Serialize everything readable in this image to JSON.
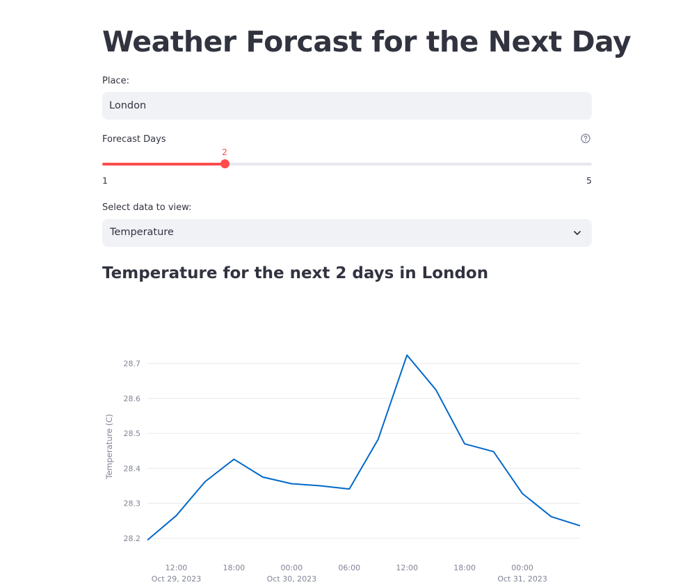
{
  "header": {
    "title": "Weather Forcast for the Next Day"
  },
  "place": {
    "label": "Place:",
    "value": "London"
  },
  "forecast_days": {
    "label": "Forecast Days",
    "value": "2",
    "min": "1",
    "max": "5",
    "fraction": 0.25
  },
  "data_select": {
    "label": "Select data to view:",
    "selected": "Temperature"
  },
  "section": {
    "title": "Temperature for the next 2 days in London"
  },
  "icons": {
    "help": "question-circle-icon",
    "dropdown": "chevron-down-icon"
  },
  "colors": {
    "accent": "#ff4b4b",
    "line": "#0068c9",
    "input_bg": "#f0f2f6",
    "text": "#31333f"
  },
  "chart_data": {
    "type": "line",
    "title": "",
    "xlabel": "",
    "ylabel": "Temperature (C)",
    "x": [
      "2023-10-29 09:00",
      "2023-10-29 12:00",
      "2023-10-29 15:00",
      "2023-10-29 18:00",
      "2023-10-29 21:00",
      "2023-10-30 00:00",
      "2023-10-30 03:00",
      "2023-10-30 06:00",
      "2023-10-30 09:00",
      "2023-10-30 12:00",
      "2023-10-30 15:00",
      "2023-10-30 18:00",
      "2023-10-30 21:00",
      "2023-10-31 00:00",
      "2023-10-31 03:00",
      "2023-10-31 06:00"
    ],
    "series": [
      {
        "values": [
          28.195,
          28.265,
          28.362,
          28.426,
          28.375,
          28.356,
          28.35,
          28.341,
          28.483,
          28.724,
          28.625,
          28.47,
          28.448,
          28.328,
          28.262,
          28.236
        ]
      }
    ],
    "xlim": [
      "2023-10-29 09:00",
      "2023-10-31 06:00"
    ],
    "ylim": [
      28.18,
      28.745
    ],
    "y_ticks": [
      "28.2",
      "28.3",
      "28.4",
      "28.5",
      "28.6",
      "28.7"
    ],
    "x_ticks": [
      {
        "time": "12:00",
        "date": "Oct 29, 2023"
      },
      {
        "time": "18:00",
        "date": ""
      },
      {
        "time": "00:00",
        "date": "Oct 30, 2023"
      },
      {
        "time": "06:00",
        "date": ""
      },
      {
        "time": "12:00",
        "date": ""
      },
      {
        "time": "18:00",
        "date": ""
      },
      {
        "time": "00:00",
        "date": "Oct 31, 2023"
      }
    ],
    "grid": true,
    "legend": "none"
  }
}
